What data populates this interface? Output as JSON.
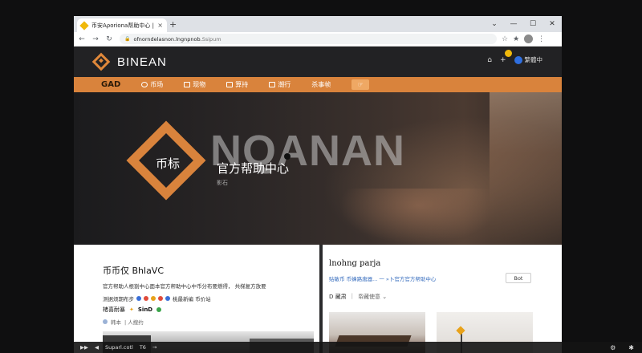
{
  "browser": {
    "tab_title": "币安Aρorionа帮助中心 | ...",
    "tab_close": "×",
    "new_tab": "+",
    "window_controls": [
      "⌄",
      "—",
      "☐",
      "✕"
    ],
    "url_primary": "ofnorndelasnon.",
    "url_highlight": "lngnpnob.",
    "url_rest": "Ssipum",
    "nav_back": "←",
    "nav_forward": "→",
    "nav_reload": "↻"
  },
  "site": {
    "logo_text": "BINEAN",
    "lang_label": "繁體中",
    "brand_nav": "GAD"
  },
  "nav": {
    "items": [
      "币场",
      "现物",
      "算持",
      "潮行",
      "杀事帧"
    ]
  },
  "hero": {
    "bg_text": "NQANAN",
    "logo_text": "币标",
    "title": "官方帮助中心",
    "subtitle": "影石"
  },
  "left_card": {
    "title": "币币仅 BhlaVC",
    "desc1": "官方帮助人根割中心面本官方帮助中心中币分布要燃得， 共梯复方放要",
    "desc2": "测据烦期布步",
    "desc2_tail": "桃最新编 币价站",
    "feature_label": "楮喜耐暴",
    "feature_brand": "SinD",
    "meta_a": "韩本",
    "meta_b": "| 人搜约"
  },
  "right_card": {
    "title": "lnohng parja",
    "link_text": "贴敏币 币蜂路唐器... 一 »卜官方官方帮助中心",
    "button_label": "Bot",
    "tab_a": "D 藏肃",
    "tab_b": "|",
    "tab_c": "帋藏使意 ⌄"
  },
  "bottom": {
    "play": "▶▶",
    "mute": "◀",
    "label": "Suparl.cotl",
    "num": "T6",
    "arrow": "→"
  }
}
